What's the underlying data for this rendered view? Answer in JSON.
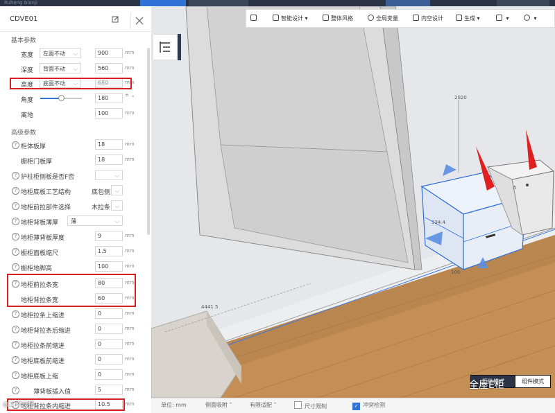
{
  "topbar": {
    "left_text": "Ruheng bianji",
    "tab_a": "",
    "tab_b": "",
    "tab_c": "",
    "tab_d": "",
    "tab_e": ""
  },
  "panel": {
    "title": "CDVE01",
    "basic_section": "基本参数",
    "basic": [
      {
        "label": "宽度",
        "mode": "左面不动",
        "value": "900",
        "unit": "mm"
      },
      {
        "label": "深度",
        "mode": "背面不动",
        "value": "560",
        "unit": "mm"
      },
      {
        "label": "高度",
        "mode": "底面不动",
        "value": "680",
        "unit": "mm"
      },
      {
        "label": "角度",
        "value": "180",
        "unit": "°"
      },
      {
        "label": "离地",
        "value": "100",
        "unit": "mm"
      }
    ],
    "advanced_section": "高级参数",
    "advanced": [
      {
        "label": "柜体板厚",
        "value": "18",
        "unit": "mm",
        "help": true
      },
      {
        "label": "橱柜门板厚",
        "value": "18",
        "unit": "mm",
        "help": false
      },
      {
        "label": "护柱柜侧板是否F否",
        "value": "",
        "unit": "",
        "help": true,
        "select": true
      },
      {
        "label": "地柜底板工艺结构",
        "select_value": "底包侧",
        "value": "",
        "unit": "",
        "help": true,
        "select": true
      },
      {
        "label": "地柜前拉部件选择",
        "select_value": "木拉条",
        "value": "",
        "unit": "",
        "help": true,
        "select": true
      },
      {
        "label": "地柜背板薄厚",
        "select_value": "薄",
        "value": "",
        "unit": "",
        "help": true,
        "select": true
      },
      {
        "label": "地柜薄背板厚度",
        "value": "9",
        "unit": "mm",
        "help": true
      },
      {
        "label": "橱柜面板缩尺",
        "value": "1.5",
        "unit": "mm",
        "help": true
      },
      {
        "label": "橱柜地脚高",
        "value": "100",
        "unit": "mm",
        "help": true
      },
      {
        "label": "地柜前拉条宽",
        "value": "80",
        "unit": "mm",
        "help": true
      },
      {
        "label": "地柜背拉条宽",
        "value": "60",
        "unit": "mm",
        "help": false
      },
      {
        "label": "地柜拉条上缩进",
        "value": "0",
        "unit": "mm",
        "help": true
      },
      {
        "label": "地柜背拉条后缩进",
        "value": "0",
        "unit": "mm",
        "help": true
      },
      {
        "label": "地柜拉条前缩进",
        "value": "0",
        "unit": "mm",
        "help": true
      },
      {
        "label": "地柜底板前缩进",
        "value": "0",
        "unit": "mm",
        "help": true
      },
      {
        "label": "地柜底板上缩",
        "value": "0",
        "unit": "mm",
        "help": true
      },
      {
        "label": "薄背板插入值",
        "value": "5",
        "unit": "mm",
        "help": true
      },
      {
        "label": "地柜背拉条内缩进",
        "value": "10.5",
        "unit": "mm",
        "help": true
      }
    ]
  },
  "toolbar": {
    "items": [
      "智能设计",
      "整体风格",
      "全局变量",
      "内空设计",
      "生成",
      "",
      ""
    ]
  },
  "viewport": {
    "dims": {
      "d2020": "2020",
      "d4441": "4441.5",
      "d3344": "334.4",
      "d100": "100",
      "d5": "5"
    },
    "colors": {
      "floor": "#b98650",
      "wall": "#e9eaec",
      "cabinet_edge": "#2f6fd6",
      "arrow": "#e02020",
      "gizmo": "#5b8fe0"
    }
  },
  "status": {
    "unit": "单位: mm",
    "side": "侧面吸附",
    "fit": "有限适配",
    "dim_limit": "尺寸限制",
    "collision": "冲突检测"
  },
  "modes": {
    "cabinet": "柜体模式",
    "component": "组件模式"
  },
  "watermark": {
    "brand": "全屋E柜",
    "left": "@工作流程"
  }
}
